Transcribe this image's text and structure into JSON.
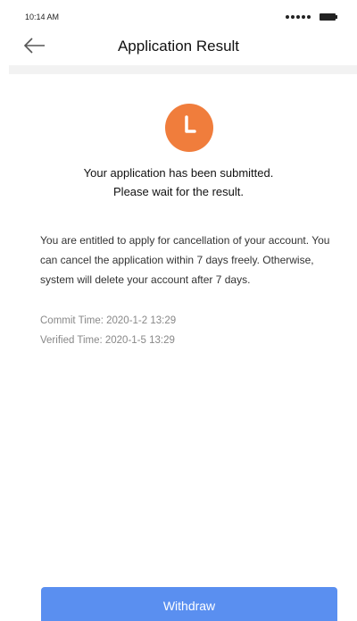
{
  "status_bar": {
    "time": "10:14 AM"
  },
  "header": {
    "title": "Application Result",
    "back_icon": "arrow-left-icon"
  },
  "result": {
    "icon": "clock-icon",
    "icon_color": "#f07d3c",
    "line1": "Your application has been submitted.",
    "line2": "Please wait for the result."
  },
  "description": "You are entitled to apply for cancellation of your account. You can cancel the application within 7 days freely. Otherwise, system will delete your account after 7 days.",
  "timeline": {
    "commit_label": "Commit Time: 2020-1-2 13:29",
    "verified_label": "Verified Time: 2020-1-5 13:29"
  },
  "actions": {
    "withdraw_label": "Withdraw",
    "withdraw_color": "#5a8ff0"
  }
}
